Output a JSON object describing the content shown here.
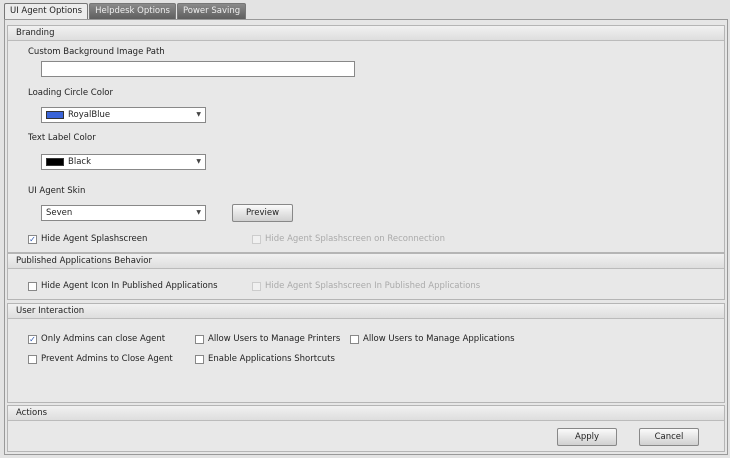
{
  "tabs": [
    "UI Agent Options",
    "Helpdesk Options",
    "Power Saving"
  ],
  "branding": {
    "title": "Branding",
    "bg_path_label": "Custom Background Image Path",
    "bg_path_value": "",
    "loading_label": "Loading Circle Color",
    "loading_value": "RoyalBlue",
    "loading_color": "#3a64d8",
    "text_label": "Text Label Color",
    "text_value": "Black",
    "text_color": "#000000",
    "skin_label": "UI Agent Skin",
    "skin_value": "Seven",
    "preview": "Preview",
    "hide_splash": "Hide Agent Splashscreen",
    "hide_splash_reconnect": "Hide Agent Splashscreen on Reconnection"
  },
  "published": {
    "title": "Published Applications Behavior",
    "hide_icon": "Hide Agent Icon In Published Applications",
    "hide_splash": "Hide Agent Splashscreen In Published Applications"
  },
  "interaction": {
    "title": "User Interaction",
    "only_admins": "Only Admins can close Agent",
    "prevent_admins": "Prevent Admins to Close Agent",
    "printers": "Allow Users to Manage Printers",
    "shortcuts": "Enable Applications Shortcuts",
    "apps": "Allow Users to Manage Applications"
  },
  "actions": {
    "title": "Actions",
    "apply": "Apply",
    "cancel": "Cancel"
  }
}
